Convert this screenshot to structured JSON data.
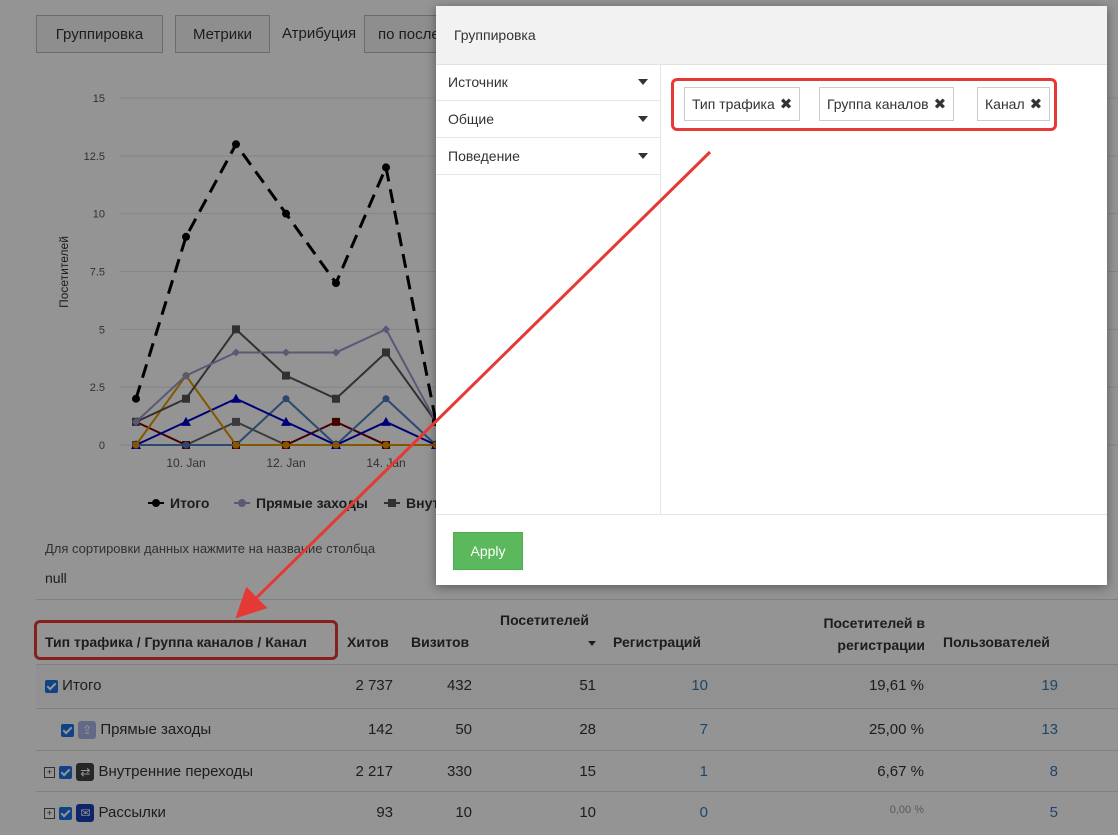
{
  "toolbar": {
    "grouping_label": "Группировка",
    "metrics_label": "Метрики",
    "attribution_label": "Атрибуция",
    "attribution_value": "по после"
  },
  "chart_data": {
    "type": "line",
    "ylabel": "Посетителей",
    "yticks": [
      "15",
      "12.5",
      "10",
      "7.5",
      "5",
      "2.5",
      "0"
    ],
    "xticks": [
      "10. Jan",
      "12. Jan",
      "14. Jan"
    ],
    "ylim": [
      0,
      15
    ],
    "x": [
      9,
      10,
      11,
      12,
      13,
      14,
      15
    ],
    "series": [
      {
        "name": "Итого",
        "color": "#000000",
        "values": [
          2,
          9,
          13,
          10,
          7,
          12,
          1
        ]
      },
      {
        "name": "Прямые заходы",
        "color": "#9999cc",
        "values": [
          1,
          3,
          4,
          4,
          4,
          5,
          1
        ]
      },
      {
        "name": "Внут",
        "color": "#555555",
        "values": [
          1,
          2,
          5,
          3,
          2,
          4,
          1
        ]
      },
      {
        "name": "",
        "color": "#e69500",
        "values": [
          0,
          3,
          0,
          0,
          0,
          0,
          0
        ]
      },
      {
        "name": "",
        "color": "#0000cc",
        "values": [
          0,
          1,
          2,
          1,
          0,
          1,
          0
        ]
      },
      {
        "name": "",
        "color": "#4a7fc1",
        "values": [
          0,
          0,
          0,
          2,
          0,
          2,
          0
        ]
      },
      {
        "name": "",
        "color": "#7a0000",
        "values": [
          1,
          0,
          0,
          0,
          1,
          0,
          0
        ]
      },
      {
        "name": "",
        "color": "#666666",
        "values": [
          0,
          0,
          1,
          0,
          0,
          0,
          0
        ]
      }
    ]
  },
  "hint": "Для сортировки данных нажмите на название столбца",
  "null_text": "null",
  "table": {
    "headers": {
      "dim": "Тип трафика / Группа каналов / Канал",
      "hits": "Хитов",
      "visits": "Визитов",
      "visitors": "Посетителей",
      "regs": "Регистраций",
      "reg_visitors": "Посетителей в регистрации",
      "users": "Пользователей"
    },
    "rows": [
      {
        "name": "Итого",
        "hits": "2 737",
        "visits": "432",
        "visitors": "51",
        "regs": "10",
        "rate": "19,61 %",
        "users": "19"
      },
      {
        "name": "Прямые заходы",
        "hits": "142",
        "visits": "50",
        "visitors": "28",
        "regs": "7",
        "rate": "25,00 %",
        "users": "13"
      },
      {
        "name": "Внутренние переходы",
        "hits": "2 217",
        "visits": "330",
        "visitors": "15",
        "regs": "1",
        "rate": "6,67 %",
        "users": "8"
      },
      {
        "name": "Рассылки",
        "hits": "93",
        "visits": "10",
        "visitors": "10",
        "regs": "0",
        "rate": "0,00 %",
        "users": "5"
      }
    ]
  },
  "modal": {
    "title": "Группировка",
    "sections": [
      "Источник",
      "Общие",
      "Поведение"
    ],
    "chips": [
      "Тип трафика",
      "Группа каналов",
      "Канал"
    ],
    "apply_label": "Apply"
  },
  "colors": {
    "accent_red": "#e53935",
    "apply_green": "#5cb85c",
    "link_blue": "#337ab7"
  }
}
